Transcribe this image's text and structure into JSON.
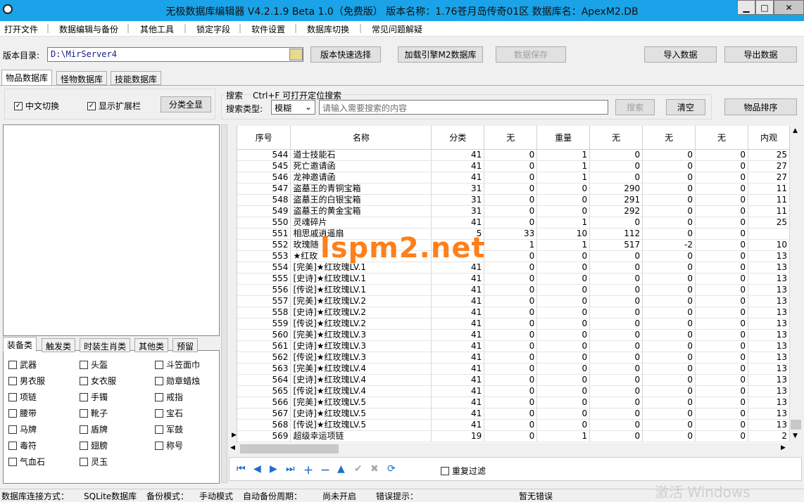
{
  "title": "无极数据库编辑器 V4.2.1.9   Beta 1.0（免费版）   版本名称：1.76苍月岛传奇01区   数据库名：ApexM2.DB",
  "window_buttons": {
    "minimize": "▁",
    "maximize": "□",
    "close": "✕"
  },
  "menu": [
    "打开文件",
    "数据编辑与备份",
    "其他工具",
    "锁定字段",
    "软件设置",
    "数据库切换",
    "常见问题解疑"
  ],
  "dir_label": "版本目录:",
  "dir_value": "D:\\MirServer4",
  "buttons": {
    "quick_select": "版本快速选择",
    "load_engine": "加载引擎M2数据库",
    "save_data": "数据保存",
    "import": "导入数据",
    "export": "导出数据",
    "show_all": "分类全显",
    "search": "搜索",
    "clear": "清空",
    "sort": "物品排序"
  },
  "tabs": [
    "物品数据库",
    "怪物数据库",
    "技能数据库"
  ],
  "options": {
    "chinese_switch": "中文切换",
    "show_ext": "显示扩展栏"
  },
  "search": {
    "label": "搜索",
    "hint": "Ctrl+F 可打开定位搜索",
    "type_label": "搜索类型:",
    "type_value": "模糊",
    "placeholder": "请输入需要搜索的内容"
  },
  "category_tabs": [
    "装备类",
    "触发类",
    "时装生肖类",
    "其他类",
    "预留"
  ],
  "categories": [
    "武器",
    "头盔",
    "斗笠面巾",
    "男衣服",
    "女衣服",
    "勋章蜡烛",
    "项链",
    "手镯",
    "戒指",
    "腰带",
    "靴子",
    "宝石",
    "马牌",
    "盾牌",
    "军鼓",
    "毒符",
    "翅膀",
    "称号",
    "气血石",
    "灵玉"
  ],
  "columns": [
    "序号",
    "名称",
    "分类",
    "无",
    "重量",
    "无",
    "无",
    "无",
    "内观"
  ],
  "rows": [
    [
      "544",
      "道士技能石",
      "41",
      "0",
      "1",
      "0",
      "0",
      "0",
      "25"
    ],
    [
      "545",
      "死亡邀请函",
      "41",
      "0",
      "1",
      "0",
      "0",
      "0",
      "27"
    ],
    [
      "546",
      "龙神邀请函",
      "41",
      "0",
      "1",
      "0",
      "0",
      "0",
      "27"
    ],
    [
      "547",
      "盗墓王的青铜宝箱",
      "31",
      "0",
      "0",
      "290",
      "0",
      "0",
      "11"
    ],
    [
      "548",
      "盗墓王的白银宝箱",
      "31",
      "0",
      "0",
      "291",
      "0",
      "0",
      "11"
    ],
    [
      "549",
      "盗墓王的黄金宝箱",
      "31",
      "0",
      "0",
      "292",
      "0",
      "0",
      "11"
    ],
    [
      "550",
      "灵魂碎片",
      "41",
      "0",
      "1",
      "0",
      "0",
      "0",
      "25"
    ],
    [
      "551",
      "相思戚逍遥扇",
      "5",
      "33",
      "10",
      "112",
      "0",
      "0",
      ""
    ],
    [
      "552",
      "玫瑰随",
      "",
      "1",
      "1",
      "517",
      "-2",
      "0",
      "10"
    ],
    [
      "553",
      "★红玫",
      "",
      "0",
      "0",
      "0",
      "0",
      "0",
      "13"
    ],
    [
      "554",
      "[完美]★红玫瑰LV.1",
      "41",
      "0",
      "0",
      "0",
      "0",
      "0",
      "13"
    ],
    [
      "555",
      "[史诗]★红玫瑰LV.1",
      "41",
      "0",
      "0",
      "0",
      "0",
      "0",
      "13"
    ],
    [
      "556",
      "[传说]★红玫瑰LV.1",
      "41",
      "0",
      "0",
      "0",
      "0",
      "0",
      "13"
    ],
    [
      "557",
      "[完美]★红玫瑰LV.2",
      "41",
      "0",
      "0",
      "0",
      "0",
      "0",
      "13"
    ],
    [
      "558",
      "[史诗]★红玫瑰LV.2",
      "41",
      "0",
      "0",
      "0",
      "0",
      "0",
      "13"
    ],
    [
      "559",
      "[传说]★红玫瑰LV.2",
      "41",
      "0",
      "0",
      "0",
      "0",
      "0",
      "13"
    ],
    [
      "560",
      "[完美]★红玫瑰LV.3",
      "41",
      "0",
      "0",
      "0",
      "0",
      "0",
      "13"
    ],
    [
      "561",
      "[史诗]★红玫瑰LV.3",
      "41",
      "0",
      "0",
      "0",
      "0",
      "0",
      "13"
    ],
    [
      "562",
      "[传说]★红玫瑰LV.3",
      "41",
      "0",
      "0",
      "0",
      "0",
      "0",
      "13"
    ],
    [
      "563",
      "[完美]★红玫瑰LV.4",
      "41",
      "0",
      "0",
      "0",
      "0",
      "0",
      "13"
    ],
    [
      "564",
      "[史诗]★红玫瑰LV.4",
      "41",
      "0",
      "0",
      "0",
      "0",
      "0",
      "13"
    ],
    [
      "565",
      "[传说]★红玫瑰LV.4",
      "41",
      "0",
      "0",
      "0",
      "0",
      "0",
      "13"
    ],
    [
      "566",
      "[完美]★红玫瑰LV.5",
      "41",
      "0",
      "0",
      "0",
      "0",
      "0",
      "13"
    ],
    [
      "567",
      "[史诗]★红玫瑰LV.5",
      "41",
      "0",
      "0",
      "0",
      "0",
      "0",
      "13"
    ],
    [
      "568",
      "[传说]★红玫瑰LV.5",
      "41",
      "0",
      "0",
      "0",
      "0",
      "0",
      "13"
    ],
    [
      "569",
      "超级幸运项链",
      "19",
      "0",
      "1",
      "0",
      "0",
      "0",
      "2"
    ]
  ],
  "nav_icons": [
    "first-icon",
    "prev-icon",
    "next-icon",
    "last-icon",
    "add-icon",
    "delete-icon",
    "up-icon",
    "confirm-icon",
    "cancel-icon",
    "refresh-icon"
  ],
  "dup_filter": "重复过滤",
  "status": {
    "conn_label": "数据库连接方式：",
    "conn_value": "SQLite数据库",
    "backup_mode_label": "备份模式：",
    "backup_mode_value": "手动模式",
    "auto_backup_label": "自动备份周期：",
    "auto_backup_value": "尚未开启",
    "error_label": "错误提示：",
    "error_value": "暂无错误"
  },
  "watermark": "lspm2.net",
  "activate_windows": "激活 Windows"
}
